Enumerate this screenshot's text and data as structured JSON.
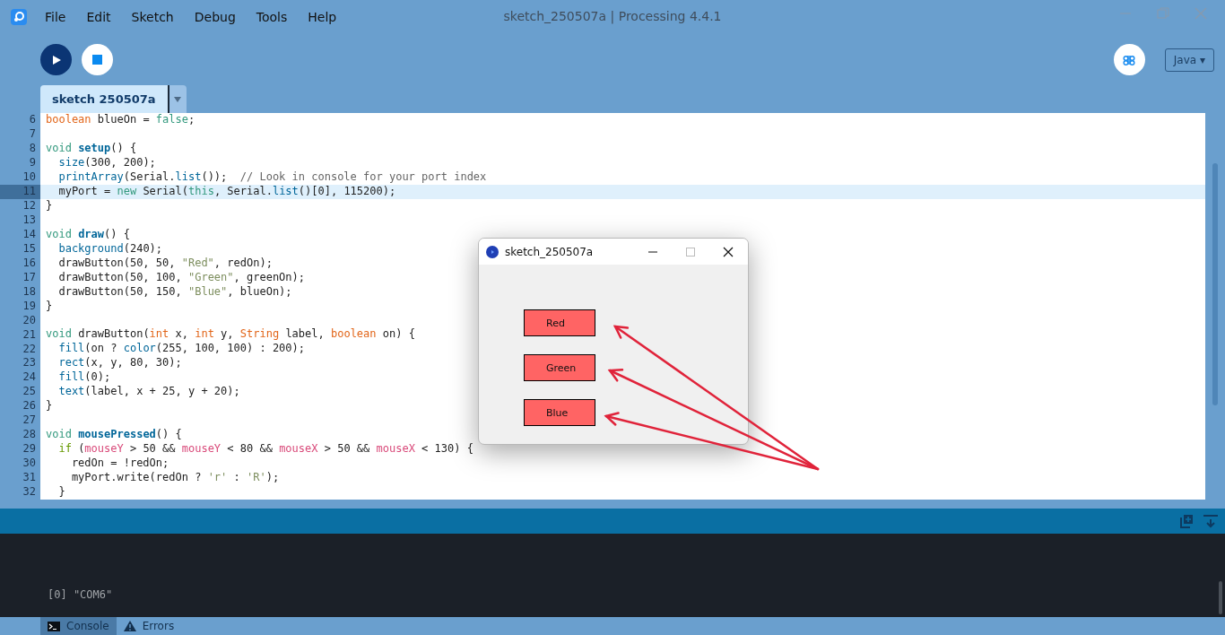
{
  "window": {
    "title": "sketch_250507a | Processing 4.4.1"
  },
  "menu": [
    "File",
    "Edit",
    "Sketch",
    "Debug",
    "Tools",
    "Help"
  ],
  "toolbar": {
    "mode": "Java ▾"
  },
  "tabs": [
    {
      "label": "sketch 250507a",
      "selected": true
    }
  ],
  "editor": {
    "lines": [
      {
        "number": "6",
        "current": false,
        "tokens": [
          {
            "kind": "type",
            "text": "boolean"
          },
          {
            "kind": "plain",
            "text": " blueOn = "
          },
          {
            "kind": "keyword",
            "text": "false"
          },
          {
            "kind": "plain",
            "text": ";"
          }
        ]
      },
      {
        "number": "7",
        "current": false
      },
      {
        "number": "8",
        "current": false,
        "tokens": [
          {
            "kind": "keyword",
            "text": "void"
          },
          {
            "kind": "definition",
            "text": " setup"
          },
          {
            "kind": "plain",
            "text": "() {"
          }
        ]
      },
      {
        "number": "9",
        "current": false,
        "tokens": [
          {
            "kind": "function",
            "text": "  size"
          },
          {
            "kind": "plain",
            "text": "(300, 200);"
          }
        ]
      },
      {
        "number": "10",
        "current": false,
        "tokens": [
          {
            "kind": "function",
            "text": "  printArray"
          },
          {
            "kind": "plain",
            "text": "(Serial."
          },
          {
            "kind": "function",
            "text": "list"
          },
          {
            "kind": "plain",
            "text": "());  "
          },
          {
            "kind": "comment",
            "text": "// Look in console for your port index"
          }
        ]
      },
      {
        "number": "11",
        "current": true,
        "tokens": [
          {
            "kind": "plain",
            "text": "  myPort = "
          },
          {
            "kind": "keyword",
            "text": "new"
          },
          {
            "kind": "plain",
            "text": " Serial("
          },
          {
            "kind": "keyword",
            "text": "this"
          },
          {
            "kind": "plain",
            "text": ", Serial."
          },
          {
            "kind": "function",
            "text": "list"
          },
          {
            "kind": "plain",
            "text": "()[0], 115200);"
          }
        ]
      },
      {
        "number": "12",
        "current": false,
        "tokens": [
          {
            "kind": "plain",
            "text": "}"
          }
        ]
      },
      {
        "number": "13",
        "current": false
      },
      {
        "number": "14",
        "current": false,
        "tokens": [
          {
            "kind": "keyword",
            "text": "void"
          },
          {
            "kind": "definition",
            "text": " draw"
          },
          {
            "kind": "plain",
            "text": "() {"
          }
        ]
      },
      {
        "number": "15",
        "current": false,
        "tokens": [
          {
            "kind": "function",
            "text": "  background"
          },
          {
            "kind": "plain",
            "text": "(240);"
          }
        ]
      },
      {
        "number": "16",
        "current": false,
        "tokens": [
          {
            "kind": "plain",
            "text": "  drawButton(50, 50, "
          },
          {
            "kind": "string",
            "text": "\"Red\""
          },
          {
            "kind": "plain",
            "text": ", redOn);"
          }
        ]
      },
      {
        "number": "17",
        "current": false,
        "tokens": [
          {
            "kind": "plain",
            "text": "  drawButton(50, 100, "
          },
          {
            "kind": "string",
            "text": "\"Green\""
          },
          {
            "kind": "plain",
            "text": ", greenOn);"
          }
        ]
      },
      {
        "number": "18",
        "current": false,
        "tokens": [
          {
            "kind": "plain",
            "text": "  drawButton(50, 150, "
          },
          {
            "kind": "string",
            "text": "\"Blue\""
          },
          {
            "kind": "plain",
            "text": ", blueOn);"
          }
        ]
      },
      {
        "number": "19",
        "current": false,
        "tokens": [
          {
            "kind": "plain",
            "text": "}"
          }
        ]
      },
      {
        "number": "20",
        "current": false
      },
      {
        "number": "21",
        "current": false,
        "tokens": [
          {
            "kind": "keyword",
            "text": "void"
          },
          {
            "kind": "plain",
            "text": " drawButton("
          },
          {
            "kind": "type",
            "text": "int"
          },
          {
            "kind": "plain",
            "text": " x, "
          },
          {
            "kind": "type",
            "text": "int"
          },
          {
            "kind": "plain",
            "text": " y, "
          },
          {
            "kind": "type",
            "text": "String"
          },
          {
            "kind": "plain",
            "text": " label, "
          },
          {
            "kind": "type",
            "text": "boolean"
          },
          {
            "kind": "plain",
            "text": " on) {"
          }
        ]
      },
      {
        "number": "22",
        "current": false,
        "tokens": [
          {
            "kind": "function",
            "text": "  fill"
          },
          {
            "kind": "plain",
            "text": "(on ? "
          },
          {
            "kind": "function",
            "text": "color"
          },
          {
            "kind": "plain",
            "text": "(255, 100, 100) : 200);"
          }
        ]
      },
      {
        "number": "23",
        "current": false,
        "tokens": [
          {
            "kind": "function",
            "text": "  rect"
          },
          {
            "kind": "plain",
            "text": "(x, y, 80, 30);"
          }
        ]
      },
      {
        "number": "24",
        "current": false,
        "tokens": [
          {
            "kind": "function",
            "text": "  fill"
          },
          {
            "kind": "plain",
            "text": "(0);"
          }
        ]
      },
      {
        "number": "25",
        "current": false,
        "tokens": [
          {
            "kind": "function",
            "text": "  text"
          },
          {
            "kind": "plain",
            "text": "(label, x + 25, y + 20);"
          }
        ]
      },
      {
        "number": "26",
        "current": false,
        "tokens": [
          {
            "kind": "plain",
            "text": "}"
          }
        ]
      },
      {
        "number": "27",
        "current": false
      },
      {
        "number": "28",
        "current": false,
        "tokens": [
          {
            "kind": "keyword",
            "text": "void"
          },
          {
            "kind": "definition",
            "text": " mousePressed"
          },
          {
            "kind": "plain",
            "text": "() {"
          }
        ]
      },
      {
        "number": "29",
        "current": false,
        "tokens": [
          {
            "kind": "control",
            "text": "  if"
          },
          {
            "kind": "plain",
            "text": " ("
          },
          {
            "kind": "variable",
            "text": "mouseY"
          },
          {
            "kind": "plain",
            "text": " > 50 && "
          },
          {
            "kind": "variable",
            "text": "mouseY"
          },
          {
            "kind": "plain",
            "text": " < 80 && "
          },
          {
            "kind": "variable",
            "text": "mouseX"
          },
          {
            "kind": "plain",
            "text": " > 50 && "
          },
          {
            "kind": "variable",
            "text": "mouseX"
          },
          {
            "kind": "plain",
            "text": " < 130) {"
          }
        ]
      },
      {
        "number": "30",
        "current": false,
        "tokens": [
          {
            "kind": "plain",
            "text": "    redOn = !redOn;"
          }
        ]
      },
      {
        "number": "31",
        "current": false,
        "tokens": [
          {
            "kind": "plain",
            "text": "    myPort.write(redOn ? "
          },
          {
            "kind": "string",
            "text": "'r'"
          },
          {
            "kind": "plain",
            "text": " : "
          },
          {
            "kind": "string",
            "text": "'R'"
          },
          {
            "kind": "plain",
            "text": ");"
          }
        ]
      },
      {
        "number": "32",
        "current": false,
        "tokens": [
          {
            "kind": "plain",
            "text": "  }"
          }
        ]
      }
    ]
  },
  "console": {
    "lines": [
      "[0] \"COM6\""
    ]
  },
  "console_tabs": [
    {
      "label": "Console",
      "selected": true,
      "kind": "console"
    },
    {
      "label": "Errors",
      "selected": false,
      "kind": "errors"
    }
  ],
  "sketch_window": {
    "title": "sketch_250507a",
    "buttons": [
      {
        "label": "Red",
        "on": true
      },
      {
        "label": "Green",
        "on": true
      },
      {
        "label": "Blue",
        "on": true
      }
    ]
  }
}
